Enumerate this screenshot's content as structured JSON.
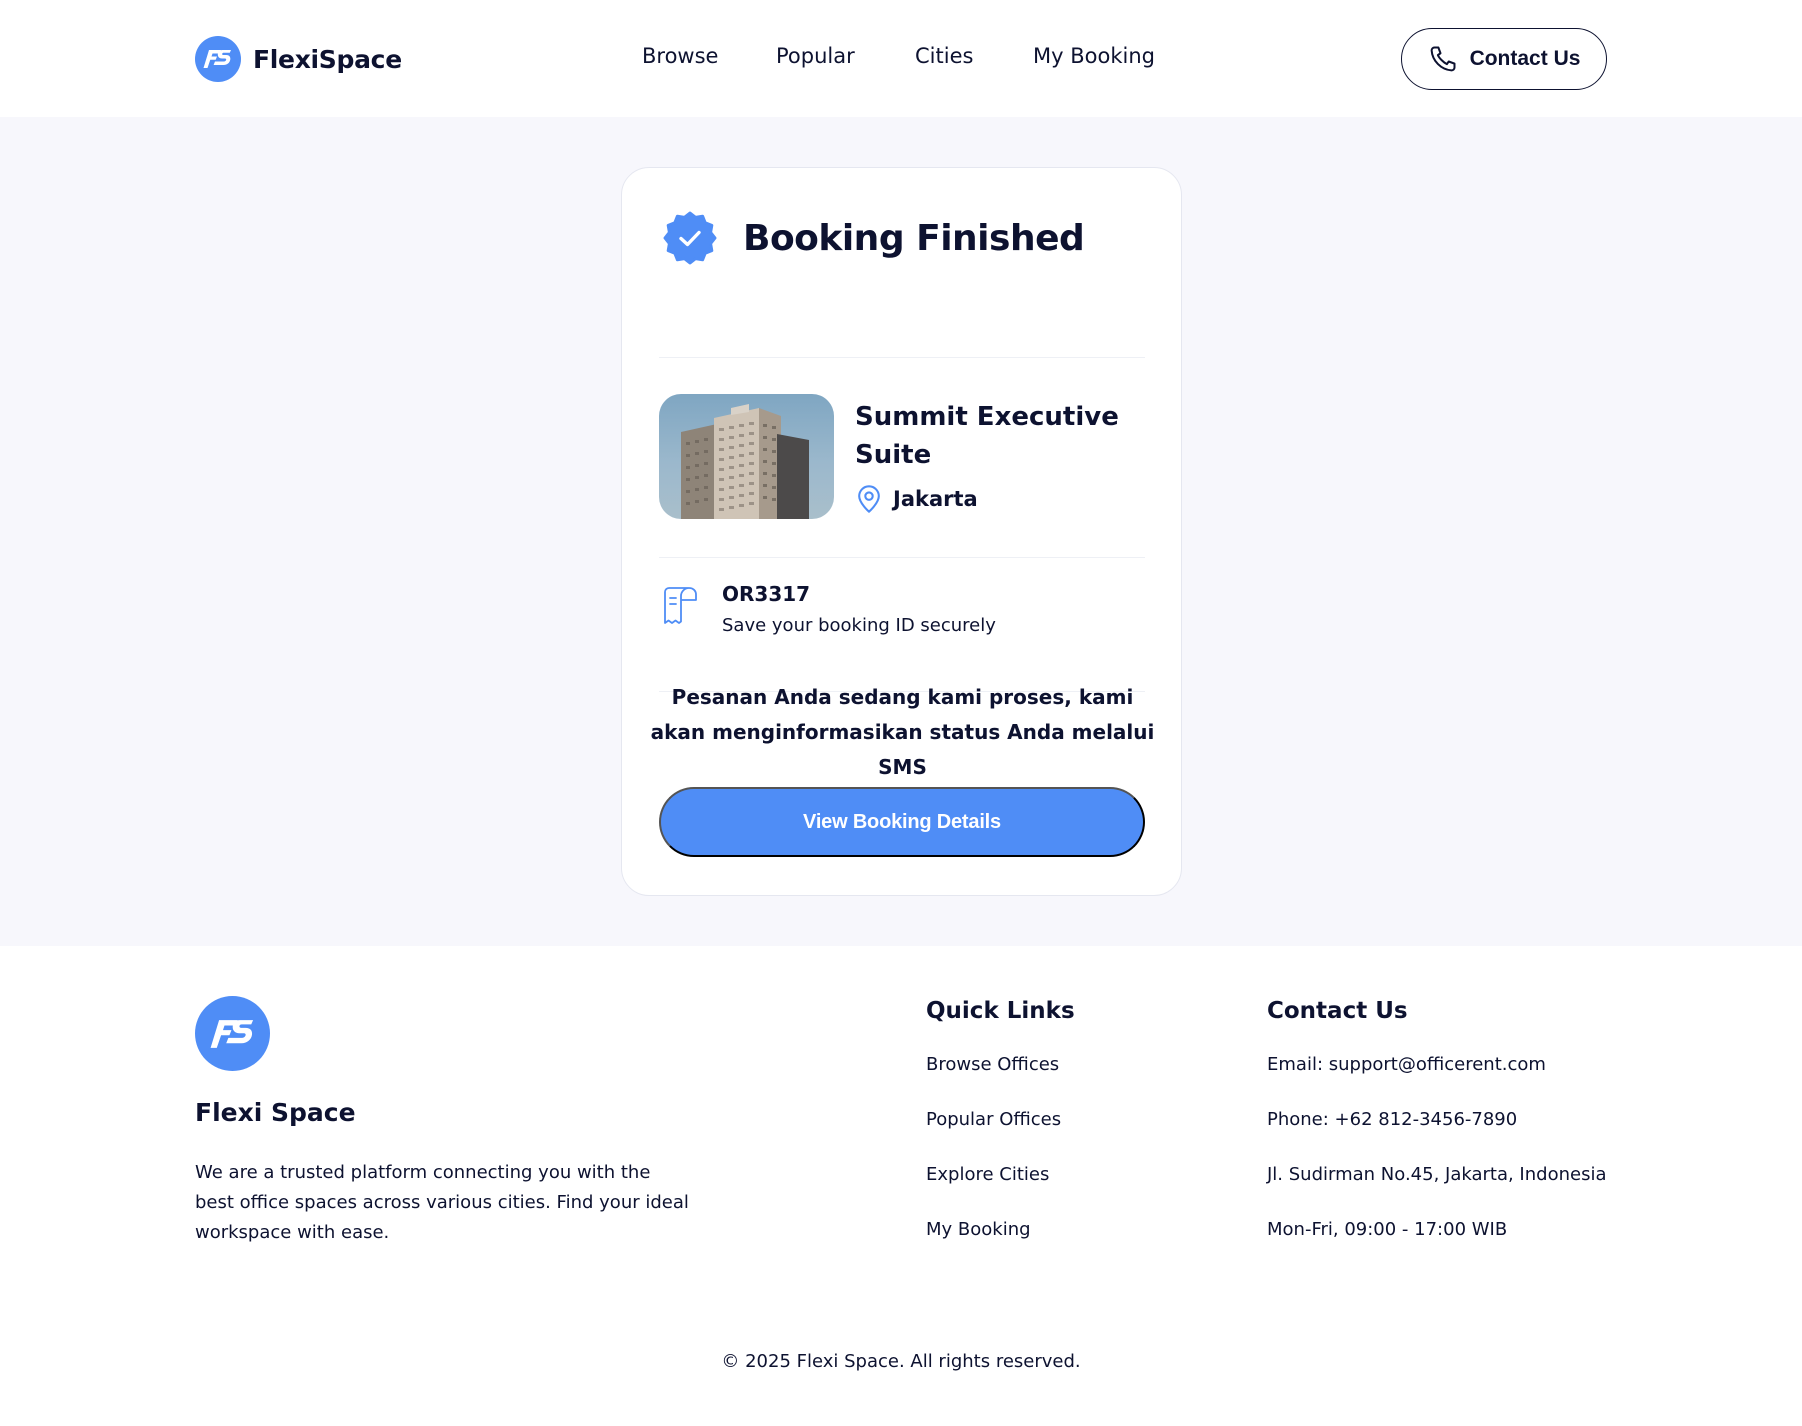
{
  "brand": {
    "name": "FlexiSpace",
    "logo_text": "FS",
    "accent": "#4F8DF6"
  },
  "nav": {
    "items": [
      "Browse",
      "Popular",
      "Cities",
      "My Booking"
    ]
  },
  "header": {
    "contact_label": "Contact Us",
    "contact_icon": "phone-icon"
  },
  "card": {
    "title": "Booking Finished",
    "badge_icon": "verified-badge-icon",
    "office": {
      "name": "Summit Executive Suite",
      "city": "Jakarta",
      "city_icon": "location-pin-icon"
    },
    "booking": {
      "id": "OR3317",
      "note": "Save your booking ID securely",
      "icon": "receipt-icon"
    },
    "message": "Pesanan Anda sedang kami proses, kami akan menginformasikan status Anda melalui SMS",
    "button_label": "View Booking Details"
  },
  "footer": {
    "brand": "Flexi Space",
    "description": "We are a trusted platform connecting you with the best office spaces across various cities. Find your ideal workspace with ease.",
    "quick_links": {
      "title": "Quick Links",
      "items": [
        "Browse Offices",
        "Popular Offices",
        "Explore Cities",
        "My Booking"
      ]
    },
    "contact": {
      "title": "Contact Us",
      "items": [
        "Email: support@officerent.com",
        "Phone: +62 812-3456-7890",
        "Jl. Sudirman No.45, Jakarta, Indonesia",
        "Mon-Fri, 09:00 - 17:00 WIB"
      ]
    },
    "copyright": "© 2025 Flexi Space. All rights reserved."
  },
  "colors": {
    "text": "#0D1230",
    "accent": "#4F8DF6",
    "page_bg": "#F7F7FC",
    "card_border": "#E5E7F0"
  }
}
